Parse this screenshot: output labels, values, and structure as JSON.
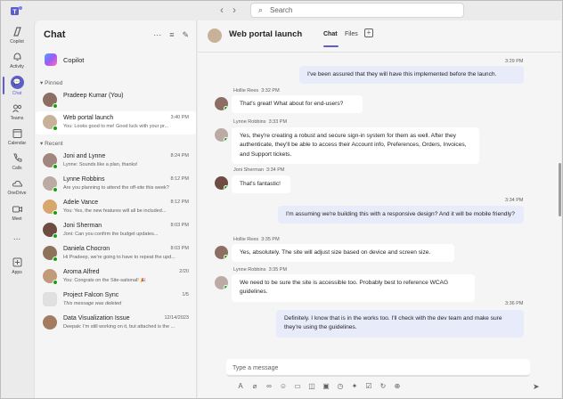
{
  "search": {
    "placeholder": "Search"
  },
  "rail": [
    {
      "label": "Copilot",
      "icon": "copilot-icon"
    },
    {
      "label": "Activity",
      "icon": "bell-icon"
    },
    {
      "label": "Chat",
      "icon": "chat-icon",
      "active": true
    },
    {
      "label": "Teams",
      "icon": "teams-icon"
    },
    {
      "label": "Calendar",
      "icon": "calendar-icon"
    },
    {
      "label": "Calls",
      "icon": "phone-icon"
    },
    {
      "label": "OneDrive",
      "icon": "cloud-icon"
    },
    {
      "label": "Meet",
      "icon": "video-icon"
    },
    {
      "label": "...",
      "icon": "more-icon"
    },
    {
      "label": "Apps",
      "icon": "apps-icon"
    }
  ],
  "chatlist": {
    "title": "Chat",
    "copilot": "Copilot",
    "pinned_label": "Pinned",
    "recent_label": "Recent",
    "pinned": [
      {
        "name": "Pradeep Kumar (You)",
        "time": "",
        "preview": ""
      },
      {
        "name": "Web portal launch",
        "time": "3:40 PM",
        "preview": "You: Looks good to me! Good luck with your pr...",
        "selected": true
      }
    ],
    "recent": [
      {
        "name": "Joni and Lynne",
        "time": "8:24 PM",
        "preview": "Lynne: Sounds like a plan, thanks!"
      },
      {
        "name": "Lynne Robbins",
        "time": "8:12 PM",
        "preview": "Are you planning to attend the off-site this week?"
      },
      {
        "name": "Adele Vance",
        "time": "8:12 PM",
        "preview": "You: Yes, the new features will all be included..."
      },
      {
        "name": "Joni Sherman",
        "time": "8:03 PM",
        "preview": "Joni: Can you confirm the budget updates..."
      },
      {
        "name": "Daniela Chocron",
        "time": "8:03 PM",
        "preview": "Hi Pradeep, we're going to have to repeat the upd..."
      },
      {
        "name": "Aroma Alfred",
        "time": "2/20",
        "preview": "You: Congrats on the Site-sational! 🎉"
      },
      {
        "name": "Project Falcon Sync",
        "time": "1/5",
        "preview": "This message was deleted",
        "italic": true
      },
      {
        "name": "Data Visualization Issue",
        "time": "12/14/2023",
        "preview": "Deepak: I'm still working on it, but attached is the ..."
      }
    ]
  },
  "main": {
    "title": "Web portal launch",
    "tabs": [
      "Chat",
      "Files"
    ],
    "messages": [
      {
        "dir": "out",
        "time": "3:29 PM",
        "text": "I've been assured that they will have this implemented before the launch."
      },
      {
        "dir": "in",
        "sender": "Hollie Rees",
        "time": "3:32 PM",
        "text": "That's great! What about for end-users?"
      },
      {
        "dir": "in",
        "sender": "Lynne Robbins",
        "time": "3:33 PM",
        "text": "Yes, they're creating a robust and secure sign-in system for them as well. After they authenticate, they'll be able to access their Account info, Preferences, Orders, Invoices, and Support tickets."
      },
      {
        "dir": "in",
        "sender": "Joni Sherman",
        "time": "3:34 PM",
        "text": "That's fantastic!"
      },
      {
        "dir": "out",
        "time": "3:34 PM",
        "text": "I'm assuming we're building this with a responsive design? And it will be mobile friendly?"
      },
      {
        "dir": "in",
        "sender": "Hollie Rees",
        "time": "3:35 PM",
        "text": "Yes, absolutely. The site will adjust size based on device and screen size."
      },
      {
        "dir": "in",
        "sender": "Lynne Robbins",
        "time": "3:35 PM",
        "text": "We need to be sure the site is accessible too. Probably best to reference WCAG guidelines."
      },
      {
        "dir": "out",
        "time": "3:36 PM",
        "text": "Definitely. I know that is in the works too. I'll check with the dev team and make sure they're using the guidelines."
      }
    ],
    "compose_placeholder": "Type a message"
  },
  "colors": {
    "accent": "#5b5fc7",
    "outgoing_bubble": "#e8ebfa",
    "presence": "#13a10e"
  }
}
